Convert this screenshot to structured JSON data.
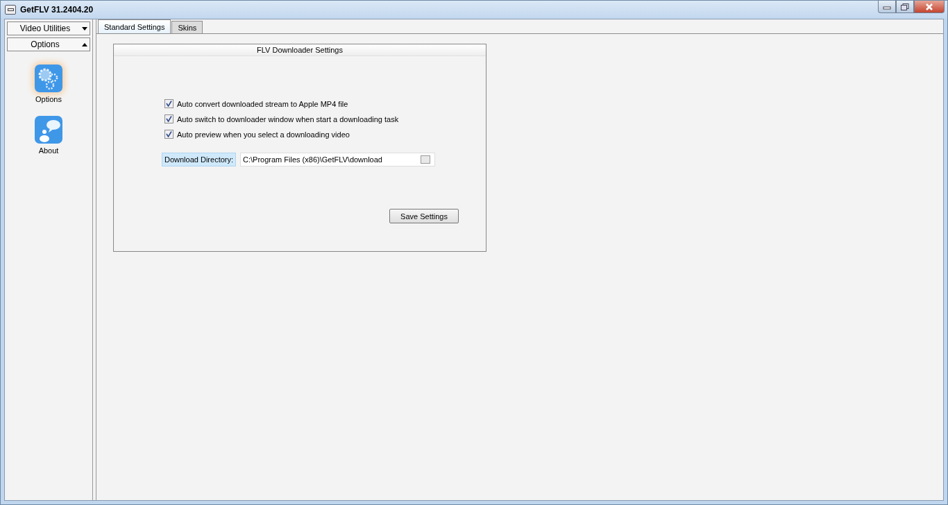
{
  "window": {
    "title": "GetFLV 31.2404.20"
  },
  "sidebar": {
    "sections": [
      {
        "label": "Video Utilities",
        "expanded": false
      },
      {
        "label": "Options",
        "expanded": true
      }
    ],
    "items": [
      {
        "label": "Options",
        "kind": "gears",
        "selected": true
      },
      {
        "label": "About",
        "kind": "chat",
        "selected": false
      }
    ]
  },
  "tabs": [
    {
      "label": "Standard Settings",
      "selected": true
    },
    {
      "label": "Skins",
      "selected": false
    }
  ],
  "group": {
    "title": "FLV Downloader Settings",
    "options": [
      {
        "label": "Auto convert downloaded stream to Apple MP4 file",
        "checked": true
      },
      {
        "label": "Auto switch to downloader window when start a downloading task",
        "checked": true
      },
      {
        "label": "Auto preview when you select a downloading video",
        "checked": true
      }
    ],
    "directory": {
      "label": "Download Directory:",
      "value": "C:\\Program Files (x86)\\GetFLV\\download"
    },
    "save_button": "Save Settings"
  }
}
